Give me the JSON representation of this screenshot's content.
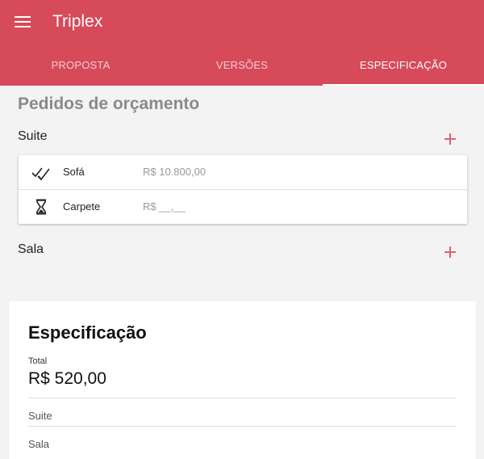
{
  "app": {
    "title": "Triplex"
  },
  "tabs": [
    {
      "label": "PROPOSTA",
      "active": false
    },
    {
      "label": "VERSÕES",
      "active": false
    },
    {
      "label": "ESPECIFICAÇÃO",
      "active": true
    }
  ],
  "section_title": "Pedidos de orçamento",
  "groups": [
    {
      "name": "Suite",
      "items": [
        {
          "name": "Sofá",
          "price": "R$ 10.800,00",
          "status_icon": "double-check-icon"
        },
        {
          "name": "Carpete",
          "price": "R$ __,__",
          "status_icon": "hourglass-icon"
        }
      ]
    },
    {
      "name": "Sala",
      "items": []
    }
  ],
  "spec": {
    "title": "Especificação",
    "total_label": "Total",
    "total_value": "R$ 520,00",
    "items": [
      "Suite",
      "Sala"
    ]
  },
  "colors": {
    "primary": "#d64a5a",
    "accent_plus": "#e06070",
    "background": "#f3f3f3"
  }
}
